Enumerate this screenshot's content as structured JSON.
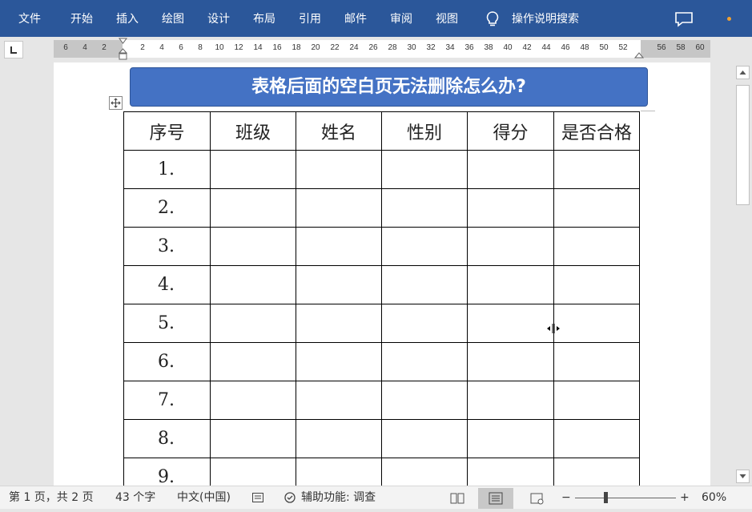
{
  "ribbon": {
    "tabs": [
      {
        "label": "文件"
      },
      {
        "label": "开始"
      },
      {
        "label": "插入"
      },
      {
        "label": "绘图"
      },
      {
        "label": "设计"
      },
      {
        "label": "布局"
      },
      {
        "label": "引用"
      },
      {
        "label": "邮件"
      },
      {
        "label": "审阅"
      },
      {
        "label": "视图"
      }
    ],
    "search_label": "操作说明搜索",
    "icons": {
      "search": "lightbulb-icon",
      "comment": "comment-icon"
    },
    "bg_color": "#2b579a",
    "notify_dot_color": "#f0a030"
  },
  "ruler": {
    "left_numbers": [
      "6",
      "4",
      "2"
    ],
    "numbers": [
      "2",
      "4",
      "6",
      "8",
      "10",
      "12",
      "14",
      "16",
      "18",
      "20",
      "22",
      "24",
      "26",
      "28",
      "30",
      "32",
      "34",
      "36",
      "38",
      "40",
      "42",
      "44",
      "46",
      "48",
      "50",
      "52"
    ],
    "right_numbers": [
      "56",
      "58",
      "60"
    ]
  },
  "document": {
    "title": "表格后面的空白页无法删除怎么办?",
    "title_bg_color": "#4472c4",
    "table": {
      "headers": [
        "序号",
        "班级",
        "姓名",
        "性别",
        "得分",
        "是否合格"
      ],
      "rows": [
        [
          "1.",
          "",
          "",
          "",
          "",
          ""
        ],
        [
          "2.",
          "",
          "",
          "",
          "",
          ""
        ],
        [
          "3.",
          "",
          "",
          "",
          "",
          ""
        ],
        [
          "4.",
          "",
          "",
          "",
          "",
          ""
        ],
        [
          "5.",
          "",
          "",
          "",
          "",
          ""
        ],
        [
          "6.",
          "",
          "",
          "",
          "",
          ""
        ],
        [
          "7.",
          "",
          "",
          "",
          "",
          ""
        ],
        [
          "8.",
          "",
          "",
          "",
          "",
          ""
        ],
        [
          "9.",
          "",
          "",
          "",
          "",
          ""
        ]
      ]
    }
  },
  "status": {
    "page_info": "第 1 页，共 2 页",
    "word_count": "43 个字",
    "language": "中文(中国)",
    "accessibility": "辅助功能: 调查",
    "zoom_minus": "−",
    "zoom_plus": "+",
    "zoom": "60%"
  }
}
